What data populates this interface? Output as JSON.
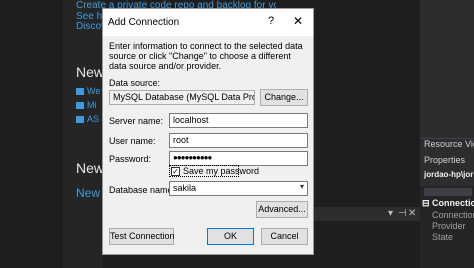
{
  "background": {
    "links": [
      "Create a private code repo and backlog for your project",
      "See ho",
      "Discove"
    ],
    "heading_new": "New",
    "items": [
      "We",
      "Mi",
      "AS"
    ],
    "heading_news": "News",
    "news_link": "New",
    "toolbar_glyphs": [
      "▾",
      "⊣",
      "✕"
    ]
  },
  "resource_view": {
    "title": "Resource View",
    "properties": "Properties",
    "toolbar_item": "jordao-hp\\jor",
    "section": "Connection",
    "props": [
      "Connection",
      "Provider",
      "State"
    ]
  },
  "dialog": {
    "title": "Add Connection",
    "help": "?",
    "close": "✕",
    "intro": "Enter information to connect to the selected data source or click \"Change\" to choose a different data source and/or provider.",
    "data_source_label": "Data source:",
    "data_source_value": "MySQL Database (MySQL Data Provider)",
    "change_button": "Change...",
    "server_label": "Server name:",
    "server_value": "localhost",
    "user_label": "User name:",
    "user_value": "root",
    "password_label": "Password:",
    "password_value": "●●●●●●●●●●",
    "save_password_label": "Save my password",
    "save_password_checked": true,
    "database_label": "Database name:",
    "database_value": "sakila",
    "advanced_button": "Advanced...",
    "test_button": "Test Connection",
    "ok_button": "OK",
    "cancel_button": "Cancel"
  }
}
